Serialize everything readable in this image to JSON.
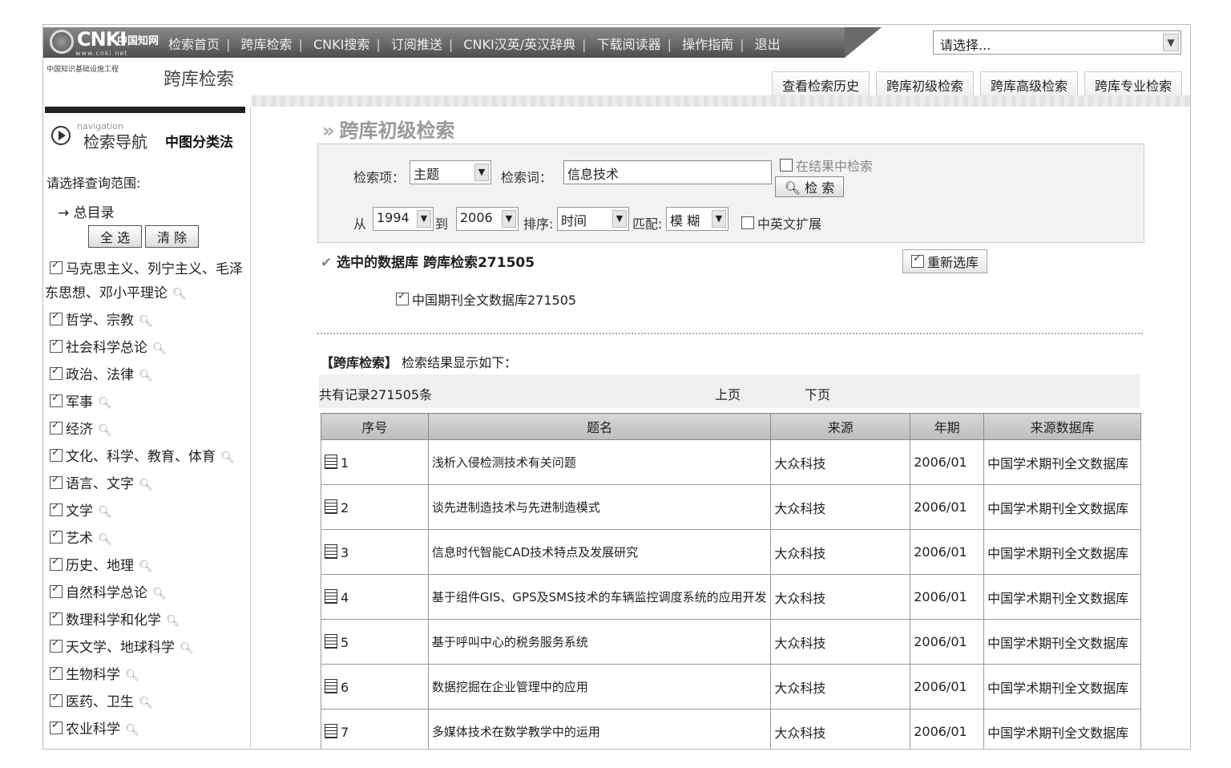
{
  "header": {
    "logo_text": "CNKI",
    "logo_cn": "中国知网",
    "logo_url": "www.cnki.net",
    "nav": [
      "检索首页",
      "跨库检索",
      "CNKI搜索",
      "订阅推送",
      "CNKI汉英/英汉辞典",
      "下载阅读器",
      "操作指南",
      "退出"
    ],
    "select_value": "请选择..."
  },
  "subheader": {
    "tagline": "中国知识基础设施工程",
    "title": "跨库检索",
    "tabs": [
      "查看检索历史",
      "跨库初级检索",
      "跨库高级检索",
      "跨库专业检索"
    ]
  },
  "sidebar": {
    "nav_en": "navigation",
    "nav_zh": "检索导航",
    "classification": "中图分类法",
    "scope_label": "请选择查询范围:",
    "root": "总目录",
    "select_all": "全 选",
    "clear": "清 除",
    "categories": [
      "马克思主义、列宁主义、毛泽",
      "东思想、邓小平理论",
      "哲学、宗教",
      "社会科学总论",
      "政治、法律",
      "军事",
      "经济",
      "文化、科学、教育、体育",
      "语言、文字",
      "文学",
      "艺术",
      "历史、地理",
      "自然科学总论",
      "数理科学和化学",
      "天文学、地球科学",
      "生物科学",
      "医药、卫生",
      "农业科学"
    ]
  },
  "search": {
    "page_title": "跨库初级检索",
    "field_label": "检索项：",
    "field_value": "主题",
    "term_label": "检索词：",
    "term_value": "信息技术",
    "in_results": "在结果中检索",
    "search_btn": "检 索",
    "from_label": "从",
    "from_year": "1994",
    "to_label": "到",
    "to_year": "2006",
    "sort_label": "排序:",
    "sort_value": "时间",
    "match_label": "匹配:",
    "match_value": "模 糊",
    "expand": "中英文扩展"
  },
  "databases": {
    "selected_label": "选中的数据库",
    "cross_label": "跨库检索271505",
    "reselect": "重新选库",
    "db_item": "中国期刊全文数据库271505"
  },
  "results": {
    "header_bracket": "【跨库检索】",
    "header_text": "检索结果显示如下：",
    "total": "共有记录271505条",
    "prev": "上页",
    "next": "下页",
    "columns": [
      "序号",
      "题名",
      "来源",
      "年期",
      "来源数据库"
    ],
    "rows": [
      {
        "no": "1",
        "title": "浅析入侵检测技术有关问题",
        "source": "大众科技",
        "issue": "2006/01",
        "db": "中国学术期刊全文数据库"
      },
      {
        "no": "2",
        "title": "谈先进制造技术与先进制造模式",
        "source": "大众科技",
        "issue": "2006/01",
        "db": "中国学术期刊全文数据库"
      },
      {
        "no": "3",
        "title": "信息时代智能CAD技术特点及发展研究",
        "source": "大众科技",
        "issue": "2006/01",
        "db": "中国学术期刊全文数据库"
      },
      {
        "no": "4",
        "title": "基于组件GIS、GPS及SMS技术的车辆监控调度系统的应用开发",
        "source": "大众科技",
        "issue": "2006/01",
        "db": "中国学术期刊全文数据库"
      },
      {
        "no": "5",
        "title": "基于呼叫中心的税务服务系统",
        "source": "大众科技",
        "issue": "2006/01",
        "db": "中国学术期刊全文数据库"
      },
      {
        "no": "6",
        "title": "数据挖掘在企业管理中的应用",
        "source": "大众科技",
        "issue": "2006/01",
        "db": "中国学术期刊全文数据库"
      },
      {
        "no": "7",
        "title": "多媒体技术在数学教学中的运用",
        "source": "大众科技",
        "issue": "2006/01",
        "db": "中国学术期刊全文数据库"
      }
    ]
  }
}
